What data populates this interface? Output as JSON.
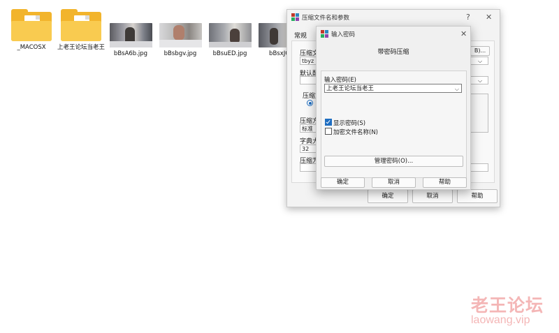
{
  "desktop": {
    "files": [
      {
        "type": "folder",
        "label": "_MACOSX"
      },
      {
        "type": "folder",
        "label": "上老王论坛当老王"
      },
      {
        "type": "image",
        "label": "bBsA6b.jpg"
      },
      {
        "type": "image",
        "label": "bBsbgv.jpg"
      },
      {
        "type": "image",
        "label": "bBsuED.jpg"
      },
      {
        "type": "image",
        "label": "bBsxJO"
      }
    ]
  },
  "main_dialog": {
    "title": "压缩文件名和参数",
    "help_icon": "?",
    "close_icon": "✕",
    "tab": "常规",
    "archive_name_label": "压缩文",
    "archive_name_value": "tbyz",
    "browse_label": "B)...",
    "profile_label": "默认配",
    "format_group_label": "压缩文",
    "method_label": "压缩方",
    "method_value": "标准",
    "dict_label": "字典大",
    "dict_value": "32",
    "split_label": "压缩为",
    "ok_label": "确定",
    "cancel_label": "取消",
    "help_label": "帮助"
  },
  "password_dialog": {
    "title": "输入密码",
    "close_icon": "✕",
    "heading": "带密码压缩",
    "input_label": "输入密码(E)",
    "password_value": "上老王论坛当老王",
    "show_password": {
      "label": "显示密码(S)",
      "checked": true
    },
    "encrypt_names": {
      "label": "加密文件名称(N)",
      "checked": false
    },
    "manage_button": "管理密码(O)...",
    "ok_label": "确定",
    "cancel_label": "取消",
    "help_label": "帮助"
  },
  "watermark": {
    "title": "老王论坛",
    "url": "laowang.vip"
  },
  "colors": {
    "folder": "#f2b42c",
    "checkbox_accent": "#1f6ec1",
    "watermark": "#f4b6b6"
  }
}
